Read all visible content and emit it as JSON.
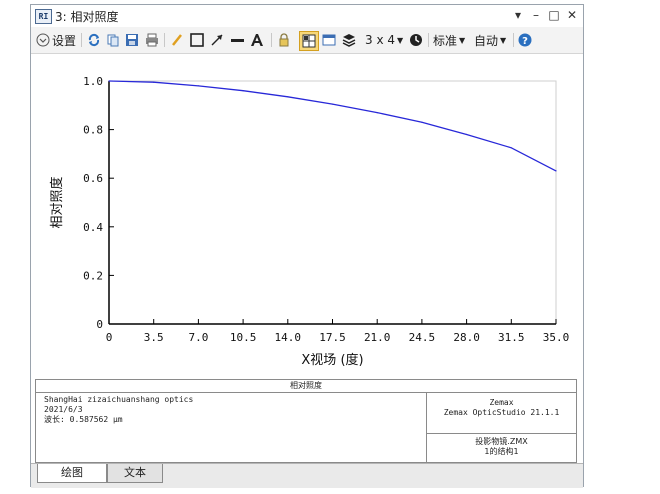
{
  "window": {
    "icon_text": "RI",
    "title": "3: 相对照度",
    "controls": {
      "dropdown": "▾",
      "minimize": "–",
      "maximize": "□",
      "close": "✕"
    }
  },
  "toolbar": {
    "settings_label": "设置",
    "grid_label": "3 x 4",
    "standard_label": "标准",
    "auto_label": "自动",
    "icons": [
      "chevron-down-circle",
      "refresh",
      "copy",
      "save",
      "print",
      "pencil",
      "rectangle",
      "arrow",
      "line",
      "text",
      "lock",
      "layout",
      "window",
      "layers",
      "grid",
      "clock",
      "dropdown",
      "dropdown",
      "help"
    ]
  },
  "chart_data": {
    "type": "line",
    "xlabel": "X视场 (度)",
    "ylabel": "相对照度",
    "xlim": [
      0,
      35
    ],
    "ylim": [
      0,
      1.0
    ],
    "xticks": [
      "0",
      "3.5",
      "7.0",
      "10.5",
      "14.0",
      "17.5",
      "21.0",
      "24.5",
      "28.0",
      "31.5",
      "35.0"
    ],
    "yticks": [
      "0",
      "0.2",
      "0.4",
      "0.6",
      "0.8",
      "1.0"
    ],
    "grid": false,
    "series": [
      {
        "color": "#2828d8",
        "x": [
          0,
          3.5,
          7.0,
          10.5,
          14.0,
          17.5,
          21.0,
          24.5,
          28.0,
          31.5,
          35.0
        ],
        "y": [
          1.0,
          0.995,
          0.98,
          0.96,
          0.935,
          0.905,
          0.87,
          0.83,
          0.78,
          0.725,
          0.63
        ]
      }
    ]
  },
  "info": {
    "title": "相对照度",
    "left_lines": [
      "ShangHai zizaichuanshang optics",
      "2021/6/3",
      "波长: 0.587562 µm"
    ],
    "right_top_lines": [
      "Zemax",
      "Zemax OpticStudio 21.1.1"
    ],
    "right_bottom_lines": [
      "投影物镜.ZMX",
      "1的结构1"
    ]
  },
  "tabs": {
    "graph_label": "绘图",
    "text_label": "文本"
  }
}
